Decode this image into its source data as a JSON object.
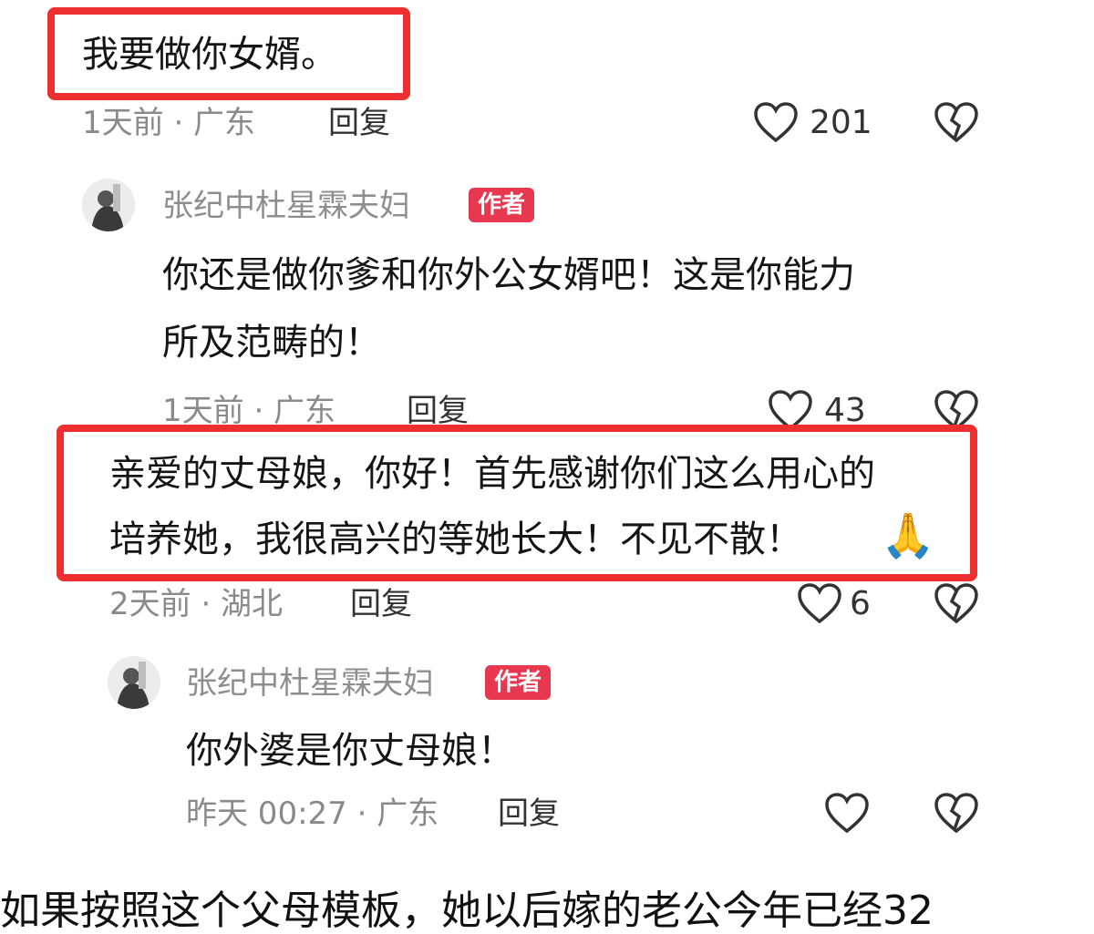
{
  "comments": [
    {
      "text": "我要做你女婿。",
      "time": "1天前 · 广东",
      "reply_label": "回复",
      "likes": "201"
    },
    {
      "author": "张纪中杜星霖夫妇",
      "badge": "作者",
      "text_line1": "你还是做你爹和你外公女婿吧！这是你能力",
      "text_line2": "所及范畴的！",
      "time": "1天前 · 广东",
      "reply_label": "回复",
      "likes": "43"
    },
    {
      "text_line1": "亲爱的丈母娘，你好！首先感谢你们这么用心的",
      "text_line2": "培养她，我很高兴的等她长大！不见不散！",
      "emoji": "🙏",
      "time": "2天前 · 湖北",
      "reply_label": "回复",
      "likes": "6"
    },
    {
      "author": "张纪中杜星霖夫妇",
      "badge": "作者",
      "text": "你外婆是你丈母娘！",
      "time": "昨天 00:27 · 广东",
      "reply_label": "回复"
    }
  ],
  "bottom_text": "如果按照这个父母模板，她以后嫁的老公今年已经32",
  "colors": {
    "highlight": "#ee2f2f",
    "badge": "#e8384f",
    "meta": "#8a8a8a"
  },
  "icons": [
    "heart-icon",
    "dislike-heart-icon",
    "pray-emoji"
  ]
}
